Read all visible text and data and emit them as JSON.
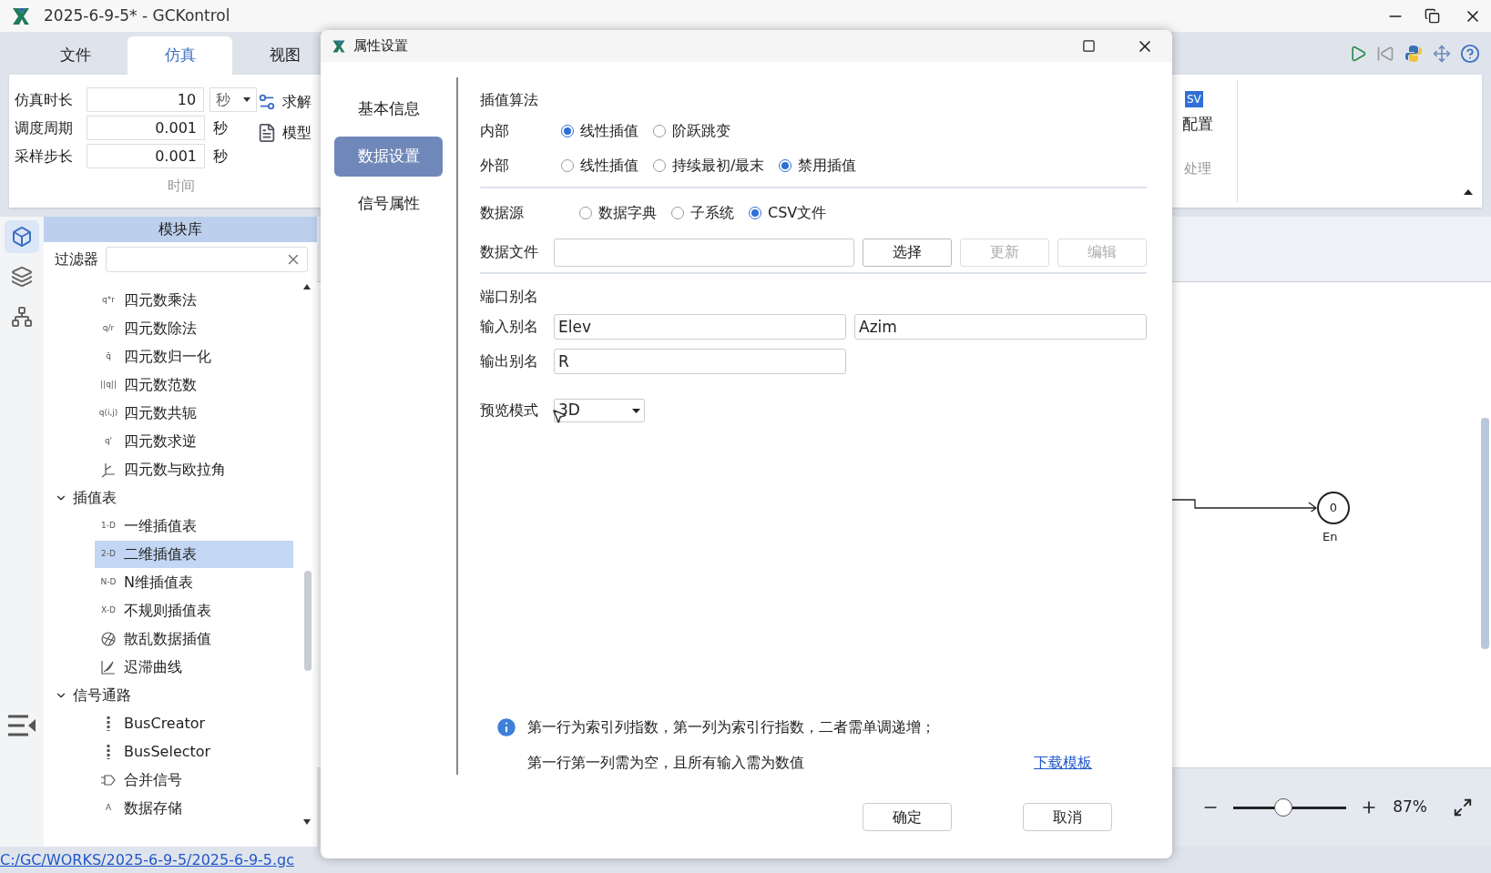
{
  "window": {
    "title": "2025-6-9-5* - GCKontrol"
  },
  "ribbon": {
    "tabs": [
      {
        "label": "文件",
        "selected": false
      },
      {
        "label": "仿真",
        "selected": true
      },
      {
        "label": "视图",
        "selected": false
      }
    ],
    "time_group": {
      "rows": [
        {
          "label": "仿真时长",
          "value": "10",
          "unit": "秒",
          "kind": "dropdown"
        },
        {
          "label": "调度周期",
          "value": "0.001",
          "unit": "秒",
          "kind": "text"
        },
        {
          "label": "采样步长",
          "value": "0.001",
          "unit": "秒",
          "kind": "text"
        }
      ],
      "caption": "时间"
    },
    "tools": [
      {
        "label": "求解",
        "kind": "solve"
      },
      {
        "label": "模型",
        "kind": "model"
      }
    ],
    "output": {
      "badge": "SV",
      "label": "配置",
      "caption": "处理"
    }
  },
  "side_tabs": [
    {
      "kind": "blocks",
      "selected": true
    },
    {
      "kind": "layers",
      "selected": false
    },
    {
      "kind": "hierarchy",
      "selected": false
    }
  ],
  "library": {
    "title": "模块库",
    "filter": {
      "label": "过滤器"
    },
    "tree": [
      {
        "label": "四元数乘法",
        "badge": "q*r",
        "selected": false
      },
      {
        "label": "四元数除法",
        "badge": "q/r",
        "selected": false
      },
      {
        "label": "四元数归一化",
        "badge": "q̄",
        "selected": false
      },
      {
        "label": "四元数范数",
        "badge": "||q||",
        "selected": false
      },
      {
        "label": "四元数共轭",
        "badge": "q(i,j)",
        "selected": false
      },
      {
        "label": "四元数求逆",
        "badge": "q'",
        "selected": false
      },
      {
        "label": "四元数与欧拉角",
        "kind": "axes",
        "selected": false
      },
      {
        "label": "插值表",
        "expanded": true,
        "children": [
          {
            "label": "一维插值表",
            "badge": "1-D",
            "selected": false
          },
          {
            "label": "二维插值表",
            "badge": "2-D",
            "selected": true
          },
          {
            "label": "N维插值表",
            "badge": "N-D",
            "selected": false
          },
          {
            "label": "不规则插值表",
            "badge": "X-D",
            "selected": false
          },
          {
            "label": "散乱数据插值",
            "kind": "scatter",
            "selected": false
          },
          {
            "label": "迟滞曲线",
            "kind": "curve",
            "selected": false
          }
        ]
      },
      {
        "label": "信号通路",
        "expanded": true,
        "children": [
          {
            "label": "BusCreator",
            "kind": "bus",
            "selected": false
          },
          {
            "label": "BusSelector",
            "kind": "bus",
            "selected": false
          },
          {
            "label": "合并信号",
            "kind": "merge",
            "selected": false
          },
          {
            "label": "数据存储",
            "badge": "A",
            "selected": false
          }
        ]
      }
    ]
  },
  "canvas": {
    "node": {
      "value": "0",
      "label": "En"
    },
    "zoom": {
      "level": 0.44,
      "reading": "87%"
    }
  },
  "status_bar": {
    "path": "C:/GC/WORKS/2025-6-9-5/2025-6-9-5.gc"
  },
  "dialog": {
    "title": "属性设置",
    "nav": [
      {
        "label": "基本信息",
        "selected": false
      },
      {
        "label": "数据设置",
        "selected": true
      },
      {
        "label": "信号属性",
        "selected": false
      }
    ],
    "interpolation": {
      "title": "插值算法",
      "rows": [
        {
          "label": "内部",
          "options": [
            {
              "label": "线性插值",
              "selected": true
            },
            {
              "label": "阶跃跳变",
              "selected": false
            }
          ]
        },
        {
          "label": "外部",
          "options": [
            {
              "label": "线性插值",
              "selected": false
            },
            {
              "label": "持续最初/最末",
              "selected": false
            },
            {
              "label": "禁用插值",
              "selected": true
            }
          ]
        }
      ]
    },
    "source": {
      "label": "数据源",
      "options": [
        {
          "label": "数据字典",
          "selected": false
        },
        {
          "label": "子系统",
          "selected": false
        },
        {
          "label": "CSV文件",
          "selected": true
        }
      ]
    },
    "file": {
      "label": "数据文件",
      "buttons": [
        {
          "label": "选择",
          "disabled": false
        },
        {
          "label": "更新",
          "disabled": true
        },
        {
          "label": "编辑",
          "disabled": true
        }
      ]
    },
    "ports": {
      "title": "端口别名",
      "inputs": {
        "label": "输入别名",
        "values": [
          "Elev",
          "Azim"
        ]
      },
      "outputs": {
        "label": "输出别名",
        "values": [
          "R"
        ]
      }
    },
    "preview": {
      "label": "预览模式",
      "value": "3D"
    },
    "note": {
      "lines": [
        "第一行为索引列指数，第一列为索引行指数，二者需单调递增；",
        "第一行第一列需为空，且所有输入需为数值"
      ],
      "link": "下载模板"
    },
    "buttons": [
      "确定",
      "取消"
    ]
  }
}
